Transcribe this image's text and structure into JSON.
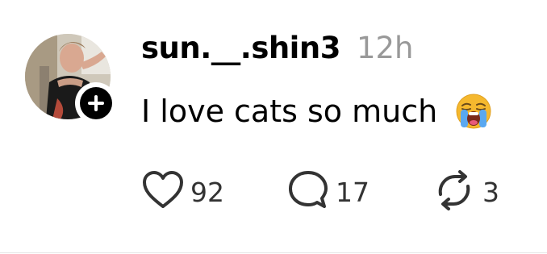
{
  "post": {
    "username": "sun.__.shin3",
    "timestamp": "12h",
    "text": "I love cats so much",
    "emoji": "loudly-crying-face-emoji"
  },
  "actions": {
    "like": {
      "icon": "heart-icon",
      "count": "92"
    },
    "reply": {
      "icon": "comment-icon",
      "count": "17"
    },
    "repost": {
      "icon": "repost-icon",
      "count": "3"
    }
  },
  "avatar": {
    "icon": "avatar",
    "follow_icon": "plus-icon"
  },
  "colors": {
    "text": "#000000",
    "muted": "#999999",
    "icon": "#333333",
    "emoji_face": "#F5B82E"
  }
}
